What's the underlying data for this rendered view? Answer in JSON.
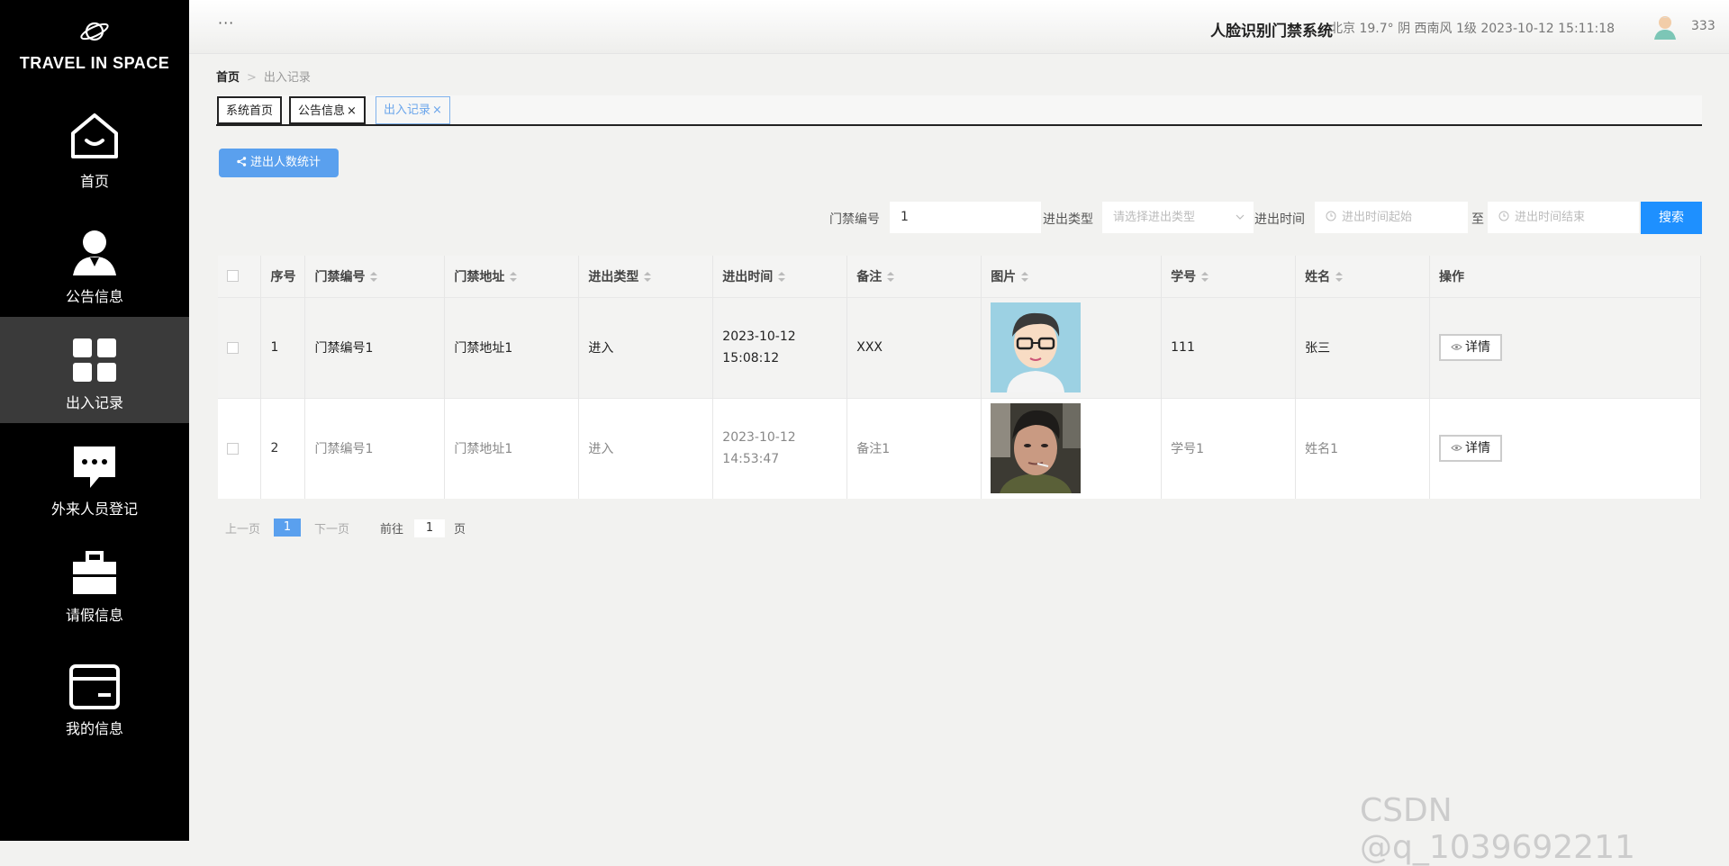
{
  "brand": "TRAVEL IN SPACE",
  "nav": [
    {
      "label": "首页",
      "icon": "home-icon"
    },
    {
      "label": "公告信息",
      "icon": "user-icon"
    },
    {
      "label": "出入记录",
      "icon": "grid-icon"
    },
    {
      "label": "外来人员登记",
      "icon": "chat-icon"
    },
    {
      "label": "请假信息",
      "icon": "briefcase-icon"
    },
    {
      "label": "我的信息",
      "icon": "card-icon"
    }
  ],
  "header": {
    "dots": "···",
    "title": "人脸识别门禁系统",
    "weather": "北京  19.7°  阴  西南风  1级  2023-10-12 15:11:18",
    "user": "333"
  },
  "breadcrumb": {
    "home": "首页",
    "sep": ">",
    "current": "出入记录"
  },
  "tabs": [
    {
      "label": "系统首页",
      "close": ""
    },
    {
      "label": "公告信息",
      "close": "×"
    },
    {
      "label": "出入记录",
      "close": "×"
    }
  ],
  "stat_button": "进出人数统计",
  "filters": {
    "gate_label": "门禁编号",
    "gate_value": "1",
    "type_label": "进出类型",
    "type_placeholder": "请选择进出类型",
    "time_label": "进出时间",
    "start_placeholder": "进出时间起始",
    "to": "至",
    "end_placeholder": "进出时间结束",
    "search": "搜索"
  },
  "table": {
    "headers": [
      "序号",
      "门禁编号",
      "门禁地址",
      "进出类型",
      "进出时间",
      "备注",
      "图片",
      "学号",
      "姓名",
      "操作"
    ],
    "rows": [
      {
        "no": "1",
        "gate": "门禁编号1",
        "addr": "门禁地址1",
        "type": "进入",
        "time": "2023-10-12 15:08:12",
        "note": "XXX",
        "sid": "111",
        "name": "张三",
        "action": "详情"
      },
      {
        "no": "2",
        "gate": "门禁编号1",
        "addr": "门禁地址1",
        "type": "进入",
        "time": "2023-10-12 14:53:47",
        "note": "备注1",
        "sid": "学号1",
        "name": "姓名1",
        "action": "详情"
      }
    ]
  },
  "pager": {
    "prev": "上一页",
    "page": "1",
    "next": "下一页",
    "goto": "前往",
    "goto_value": "1",
    "unit": "页"
  },
  "watermark": "CSDN @q_1039692211"
}
